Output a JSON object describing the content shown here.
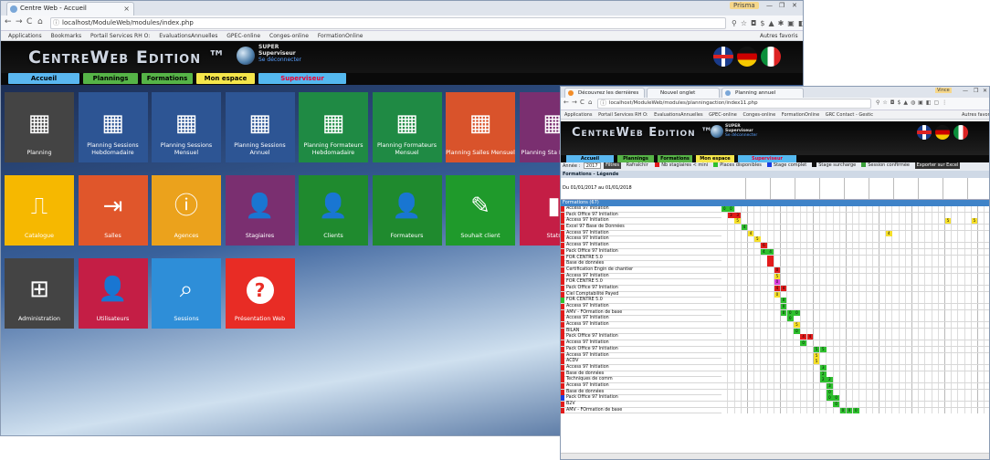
{
  "win1": {
    "tab_title": "Centre Web - Accueil",
    "address": "localhost/ModuleWeb/modules/index.php",
    "bookmarks": [
      "Applications",
      "Bookmarks",
      "Portail Services RH O:",
      "EvaluationsAnnuelles",
      "GPEC-online",
      "Conges-online",
      "FormationOnline"
    ],
    "other_bookmarks": "Autres favoris",
    "profile": "Prisma",
    "logo_main": "CentreWeb",
    "logo_edition": "Edition ™",
    "user_name": "SUPER",
    "user_role": "Superviseur",
    "logout": "Se déconnecter",
    "menu": [
      "Accueil",
      "Plannings",
      "Formations",
      "Mon espace",
      "Superviseur"
    ],
    "menu_colors": [
      "#5ab7f0",
      "#56b447",
      "#56b447",
      "#f5e64a",
      "#54b8ef"
    ],
    "tiles": [
      {
        "label": "Planning",
        "color": "#444444",
        "icon": "calendar-icon"
      },
      {
        "label": "Planning Sessions Hebdomadaire",
        "color": "#2d5594",
        "icon": "calendar-icon"
      },
      {
        "label": "Planning Sessions Mensuel",
        "color": "#2d5594",
        "icon": "calendar-icon"
      },
      {
        "label": "Planning Sessions Annuel",
        "color": "#2d5594",
        "icon": "calendar-icon"
      },
      {
        "label": "Planning Formateurs Hebdomadaire",
        "color": "#1f8a44",
        "icon": "calendar-icon"
      },
      {
        "label": "Planning Formateurs Mensuel",
        "color": "#1f8a44",
        "icon": "calendar-icon"
      },
      {
        "label": "Planning Salles Mensuel",
        "color": "#d9532b",
        "icon": "calendar-icon"
      },
      {
        "label": "Planning Sta Hebdoma",
        "color": "#7a2f70",
        "icon": "calendar-icon"
      },
      {
        "label": "Catalogue",
        "color": "#f6b800",
        "icon": "book-icon"
      },
      {
        "label": "Salles",
        "color": "#e0562b",
        "icon": "enter-icon"
      },
      {
        "label": "Agences",
        "color": "#eba21c",
        "icon": "info-icon"
      },
      {
        "label": "Stagiaires",
        "color": "#7a2f70",
        "icon": "user-icon"
      },
      {
        "label": "Clients",
        "color": "#1f8a2e",
        "icon": "user-icon"
      },
      {
        "label": "Formateurs",
        "color": "#1f8a2e",
        "icon": "user-icon"
      },
      {
        "label": "Souhait client",
        "color": "#1f9a2b",
        "icon": "pencil-icon"
      },
      {
        "label": "Stats",
        "color": "#c41e45",
        "icon": "stats-icon"
      },
      {
        "label": "Administration",
        "color": "#444444",
        "icon": "calculator-icon"
      },
      {
        "label": "Utilisateurs",
        "color": "#c41e45",
        "icon": "user-icon"
      },
      {
        "label": "Sessions",
        "color": "#2e8ed8",
        "icon": "search-icon"
      },
      {
        "label": "Présentation Web",
        "color": "#e82c25",
        "icon": "question-icon"
      }
    ]
  },
  "win2": {
    "tabs": [
      "Découvrez les dernières",
      "Nouvel onglet",
      "Planning annuel"
    ],
    "address": "localhost/ModuleWeb/modules/planningaction/index11.php",
    "bookmarks": [
      "Applications",
      "Portail Services RH O:",
      "EvaluationsAnnuelles",
      "GPEC-online",
      "Conges-online",
      "FormationOnline",
      "GRC Contact - Gestic"
    ],
    "other_bookmarks": "Autres favoris",
    "profile": "Vince",
    "logo": "CentreWeb Edition ™",
    "user_name": "SUPER",
    "user_role": "Superviseur",
    "logout": "Se déconnecter",
    "menu": [
      "Accueil",
      "Plannings",
      "Formations",
      "Mon espace",
      "Superviseur"
    ],
    "filter": {
      "year_label": "Année :",
      "year": "2017",
      "filter_btn": "Filtres",
      "refresh": "Rafraîchir",
      "chips": [
        {
          "label": "Nb stagiaires < mini",
          "color": "#e21b1b"
        },
        {
          "label": "Places disponibles",
          "color": "#2ec02e"
        },
        {
          "label": "Stage complet",
          "color": "#1a3ee0"
        },
        {
          "label": "Stage surcharge",
          "color": "#111111"
        },
        {
          "label": "Session confirmée",
          "color": "#3aa03a"
        }
      ],
      "export": "Exporter sur Excel"
    },
    "legend_title": "Formations - Légende",
    "period": "Du 01/01/2017 au 01/01/2018",
    "formations_header": "Formations (67)",
    "rows": [
      {
        "name": "Access 97 Initiation",
        "mark": "#e21b1b",
        "cells": [
          [
            0,
            "#2ec02e",
            "0"
          ],
          [
            1,
            "#2ec02e",
            "0"
          ]
        ]
      },
      {
        "name": "Pack Office 97 Initiation",
        "mark": "#e21b1b",
        "cells": [
          [
            1,
            "#e21b1b",
            "3"
          ],
          [
            2,
            "#e21b1b",
            "3"
          ]
        ]
      },
      {
        "name": "Access 97 Initiation",
        "mark": "#e21b1b",
        "cells": [
          [
            2,
            "#f6e02a",
            "5"
          ],
          [
            34,
            "#f6e02a",
            "5"
          ],
          [
            38,
            "#f6e02a",
            "5"
          ]
        ]
      },
      {
        "name": "Excel 97 Base de Données",
        "mark": "#e21b1b",
        "cells": [
          [
            3,
            "#2ec02e",
            "4"
          ]
        ]
      },
      {
        "name": "Access 97 Initiation",
        "mark": "#e21b1b",
        "cells": [
          [
            4,
            "#f6e02a",
            "4"
          ],
          [
            25,
            "#f6e02a",
            "4"
          ]
        ]
      },
      {
        "name": "Access 97 Initiation",
        "mark": "#e21b1b",
        "cells": [
          [
            5,
            "#f6e02a",
            "5"
          ]
        ]
      },
      {
        "name": "Access 97 Initiation",
        "mark": "#e21b1b",
        "cells": [
          [
            6,
            "#e21b1b",
            "6"
          ]
        ]
      },
      {
        "name": "Pack Office 97 Initiation",
        "mark": "#e21b1b",
        "cells": [
          [
            6,
            "#2ec02e",
            "4"
          ],
          [
            7,
            "#2ec02e",
            "4"
          ]
        ]
      },
      {
        "name": "FOR CENTRE 5.0",
        "mark": "#e21b1b",
        "cells": [
          [
            7,
            "#e21b1b",
            ""
          ]
        ]
      },
      {
        "name": "Base de données",
        "mark": "#e21b1b",
        "cells": [
          [
            7,
            "#e21b1b",
            ""
          ]
        ]
      },
      {
        "name": "Certification Engin de chantier",
        "mark": "#e21b1b",
        "cells": [
          [
            8,
            "#e21b1b",
            "0"
          ]
        ]
      },
      {
        "name": "Access 97 Initiation",
        "mark": "#e21b1b",
        "cells": [
          [
            8,
            "#f6e02a",
            "5"
          ]
        ]
      },
      {
        "name": "FOR CENTRE 5.0",
        "mark": "#e21b1b",
        "cells": [
          [
            8,
            "#e040e0",
            "0"
          ]
        ]
      },
      {
        "name": "Pack Office 97 Initiation",
        "mark": "#e21b1b",
        "cells": [
          [
            8,
            "#e21b1b",
            "4"
          ],
          [
            9,
            "#e21b1b",
            "4"
          ]
        ]
      },
      {
        "name": "Ciel Comptabilité Payed",
        "mark": "#e21b1b",
        "cells": [
          [
            8,
            "#f6e02a",
            "0"
          ]
        ]
      },
      {
        "name": "FOR CENTRE 5.0",
        "mark": "#2ec02e",
        "cells": [
          [
            9,
            "#2ec02e",
            "0"
          ]
        ]
      },
      {
        "name": "Access 97 Initiation",
        "mark": "#e21b1b",
        "cells": [
          [
            9,
            "#2ec02e",
            "0"
          ]
        ]
      },
      {
        "name": "AMV - FOrmation de base",
        "mark": "#e21b1b",
        "cells": [
          [
            9,
            "#2ec02e",
            "0"
          ],
          [
            10,
            "#2ec02e",
            "0"
          ],
          [
            11,
            "#2ec02e",
            "0"
          ]
        ]
      },
      {
        "name": "Access 97 Initiation",
        "mark": "#e21b1b",
        "cells": [
          [
            10,
            "#2ec02e",
            "0"
          ]
        ]
      },
      {
        "name": "Access 97 Initiation",
        "mark": "#e21b1b",
        "cells": [
          [
            11,
            "#f6e02a",
            "5"
          ]
        ]
      },
      {
        "name": "BILAN",
        "mark": "#e21b1b",
        "cells": [
          [
            11,
            "#2ec02e",
            "0"
          ]
        ]
      },
      {
        "name": "Pack Office 97 Initiation",
        "mark": "#e21b1b",
        "cells": [
          [
            12,
            "#e21b1b",
            "4"
          ],
          [
            13,
            "#e21b1b",
            "4"
          ]
        ]
      },
      {
        "name": "Access 97 Initiation",
        "mark": "#e21b1b",
        "cells": [
          [
            12,
            "#2ec02e",
            "0"
          ]
        ]
      },
      {
        "name": "Pack Office 97 Initiation",
        "mark": "#e21b1b",
        "cells": [
          [
            14,
            "#2ec02e",
            "5"
          ],
          [
            15,
            "#2ec02e",
            "5"
          ]
        ]
      },
      {
        "name": "Access 97 Initiation",
        "mark": "#e21b1b",
        "cells": [
          [
            14,
            "#f6e02a",
            "5"
          ]
        ]
      },
      {
        "name": "ACDV",
        "mark": "#e21b1b",
        "cells": [
          [
            14,
            "#f6e02a",
            "5"
          ]
        ]
      },
      {
        "name": "Access 97 Initiation",
        "mark": "#e21b1b",
        "cells": [
          [
            15,
            "#2ec02e",
            "3"
          ]
        ]
      },
      {
        "name": "Base de données",
        "mark": "#e21b1b",
        "cells": [
          [
            15,
            "#2ec02e",
            "2"
          ]
        ]
      },
      {
        "name": "Techniques de comm",
        "mark": "#e21b1b",
        "cells": [
          [
            15,
            "#2ec02e",
            "2"
          ],
          [
            16,
            "#2ec02e",
            "2"
          ]
        ]
      },
      {
        "name": "Access 97 Initiation",
        "mark": "#e21b1b",
        "cells": [
          [
            16,
            "#2ec02e",
            "3"
          ]
        ]
      },
      {
        "name": "Base de données",
        "mark": "#e21b1b",
        "cells": [
          [
            16,
            "#2ec02e",
            "0"
          ]
        ]
      },
      {
        "name": "Pack Office 97 Initiation",
        "mark": "#1a3ee0",
        "cells": [
          [
            16,
            "#2ec02e",
            "0"
          ],
          [
            17,
            "#2ec02e",
            "0"
          ]
        ]
      },
      {
        "name": "B2V",
        "mark": "#e21b1b",
        "cells": [
          [
            17,
            "#2ec02e",
            "0"
          ]
        ]
      },
      {
        "name": "AMV - FOrmation de base",
        "mark": "#e21b1b",
        "cells": [
          [
            18,
            "#2ec02e",
            "0"
          ],
          [
            19,
            "#2ec02e",
            "0"
          ],
          [
            20,
            "#2ec02e",
            "0"
          ]
        ]
      }
    ]
  }
}
